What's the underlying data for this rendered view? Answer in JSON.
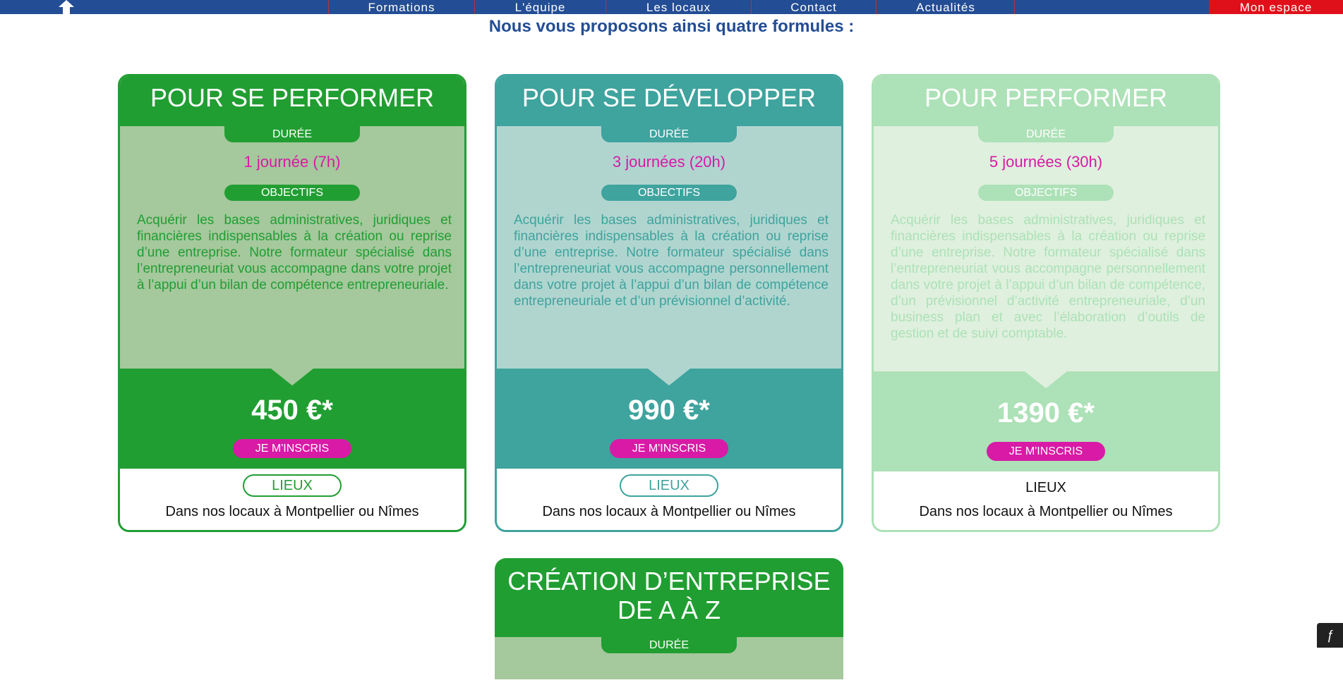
{
  "nav": {
    "items": [
      "Formations",
      "L'équipe",
      "Les locaux",
      "Contact",
      "Actualités"
    ],
    "mon_espace": "Mon espace"
  },
  "headline": "Nous vous proposons ainsi quatre formules :",
  "cards": [
    {
      "title": "POUR SE PERFORMER",
      "duree_label": "DURÉE",
      "duree": "1 journée (7h)",
      "objectifs_label": "OBJECTIFS",
      "description": "Acquérir les bases administratives, juridiques et financières indispensables à la création ou reprise d’une entreprise. Notre formateur spécialisé dans l’entrepreneuriat vous accompagne dans votre projet à l’appui d’un bilan de compétence entrepreneuriale.",
      "price": "450 €*",
      "cta": "JE M'INSCRIS",
      "lieux_label": "LIEUX",
      "lieux": "Dans nos locaux à Montpellier ou Nîmes"
    },
    {
      "title": "POUR SE DÉVELOPPER",
      "duree_label": "DURÉE",
      "duree": "3 journées (20h)",
      "objectifs_label": "OBJECTIFS",
      "description": "Acquérir les bases administratives, juridiques et financières indispensables à la création ou reprise d’une entreprise. Notre formateur spécialisé dans l’entrepreneuriat vous accompagne personnellement dans votre projet à l’appui d’un bilan de compétence entrepreneuriale et d’un prévisionnel d’activité.",
      "price": "990 €*",
      "cta": "JE M'INSCRIS",
      "lieux_label": "LIEUX",
      "lieux": "Dans nos locaux à Montpellier ou Nîmes"
    },
    {
      "title": "POUR PERFORMER",
      "duree_label": "DURÉE",
      "duree": "5 journées (30h)",
      "objectifs_label": "OBJECTIFS",
      "description": "Acquérir les bases administratives, juridiques et financières indispensables à la création ou reprise d’une entreprise. Notre formateur spécialisé dans l’entrepreneuriat vous accompagne personnellement dans votre projet à l’appui d’un bilan de compétence, d’un prévisionnel d’activité entrepreneuriale, d’un business plan et avec l’élaboration d’outils de gestion et de suivi comptable.",
      "price": "1390 €*",
      "cta": "JE M'INSCRIS",
      "lieux_label": "LIEUX",
      "lieux": "Dans nos locaux à Montpellier ou Nîmes"
    },
    {
      "title_line1": "CRÉATION D’ENTREPRISE",
      "title_line2": "DE A À Z",
      "duree_label": "DURÉE"
    }
  ],
  "icons": {
    "home": "home-icon",
    "debug": "symfony-icon"
  },
  "colors": {
    "nav_bg": "#234d94",
    "mon_espace_bg": "#e0101a",
    "green": "#219e32",
    "teal": "#3fa39e",
    "light_green": "#ade1b7",
    "magenta": "#d81aa6"
  }
}
